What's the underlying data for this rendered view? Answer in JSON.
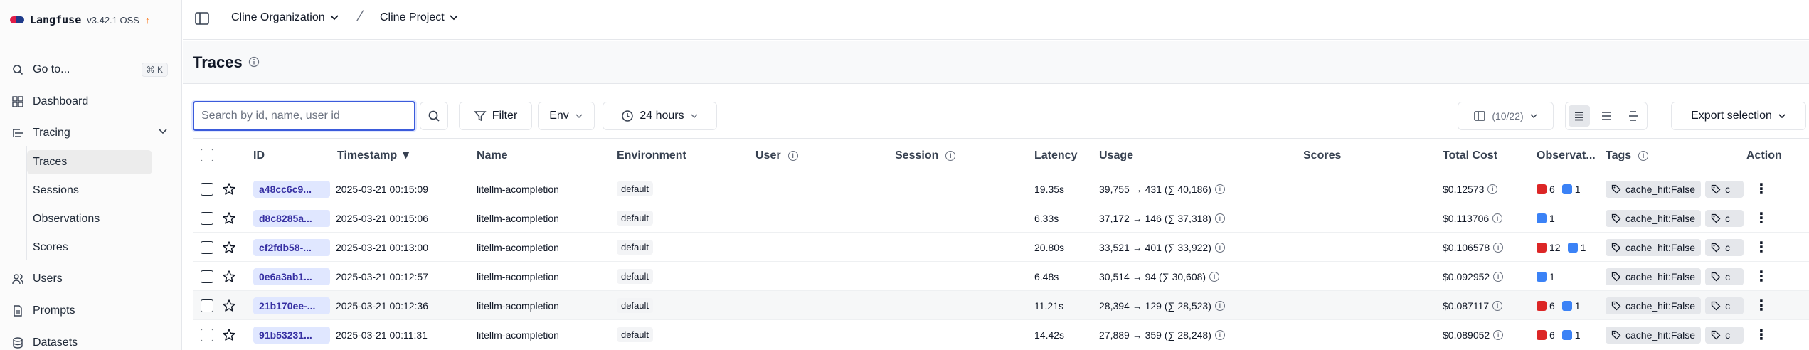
{
  "brand": {
    "name": "Langfuse",
    "version": "v3.42.1 OSS",
    "update_icon": "arrow-up-icon"
  },
  "sidebar": {
    "goto": {
      "label": "Go to...",
      "shortcut": "⌘ K"
    },
    "items": [
      {
        "label": "Dashboard",
        "icon": "dashboard-icon"
      },
      {
        "label": "Tracing",
        "icon": "tracing-icon"
      },
      {
        "label": "Users",
        "icon": "users-icon"
      },
      {
        "label": "Prompts",
        "icon": "prompts-icon"
      },
      {
        "label": "Datasets",
        "icon": "datasets-icon"
      }
    ],
    "tracing_sub": [
      "Traces",
      "Sessions",
      "Observations",
      "Scores"
    ]
  },
  "header": {
    "org": "Cline Organization",
    "project": "Cline Project"
  },
  "page": {
    "title": "Traces"
  },
  "toolbar": {
    "search_placeholder": "Search by id, name, user id",
    "filter_label": "Filter",
    "env_label": "Env",
    "time_label": "24 hours",
    "columns_label": "(10/22)",
    "export_label": "Export selection"
  },
  "table": {
    "headers": {
      "id": "ID",
      "timestamp": "Timestamp ▼",
      "name": "Name",
      "environment": "Environment",
      "user": "User",
      "session": "Session",
      "latency": "Latency",
      "usage": "Usage",
      "scores": "Scores",
      "total_cost": "Total Cost",
      "observations": "Observat...",
      "tags": "Tags",
      "action": "Action"
    },
    "rows": [
      {
        "id": "a48cc6c9...",
        "timestamp": "2025-03-21 00:15:09",
        "name": "litellm-acompletion",
        "env": "default",
        "latency": "19.35s",
        "usage": "39,755 → 431 (∑ 40,186)",
        "cost": "$0.12573",
        "obs_red": "6",
        "obs_blue": "1",
        "tag": "cache_hit:False",
        "tag2": "c"
      },
      {
        "id": "d8c8285a...",
        "timestamp": "2025-03-21 00:15:06",
        "name": "litellm-acompletion",
        "env": "default",
        "latency": "6.33s",
        "usage": "37,172 → 146 (∑ 37,318)",
        "cost": "$0.113706",
        "obs_red": "",
        "obs_blue": "1",
        "tag": "cache_hit:False",
        "tag2": "c"
      },
      {
        "id": "cf2fdb58-...",
        "timestamp": "2025-03-21 00:13:00",
        "name": "litellm-acompletion",
        "env": "default",
        "latency": "20.80s",
        "usage": "33,521 → 401 (∑ 33,922)",
        "cost": "$0.106578",
        "obs_red": "12",
        "obs_blue": "1",
        "tag": "cache_hit:False",
        "tag2": "c"
      },
      {
        "id": "0e6a3ab1...",
        "timestamp": "2025-03-21 00:12:57",
        "name": "litellm-acompletion",
        "env": "default",
        "latency": "6.48s",
        "usage": "30,514 → 94 (∑ 30,608)",
        "cost": "$0.092952",
        "obs_red": "",
        "obs_blue": "1",
        "tag": "cache_hit:False",
        "tag2": "c"
      },
      {
        "id": "21b170ee-...",
        "timestamp": "2025-03-21 00:12:36",
        "name": "litellm-acompletion",
        "env": "default",
        "latency": "11.21s",
        "usage": "28,394 → 129 (∑ 28,523)",
        "cost": "$0.087117",
        "obs_red": "6",
        "obs_blue": "1",
        "tag": "cache_hit:False",
        "tag2": "c"
      },
      {
        "id": "91b53231...",
        "timestamp": "2025-03-21 00:11:31",
        "name": "litellm-acompletion",
        "env": "default",
        "latency": "14.42s",
        "usage": "27,889 → 359 (∑ 28,248)",
        "cost": "$0.089052",
        "obs_red": "6",
        "obs_blue": "1",
        "tag": "cache_hit:False",
        "tag2": "c"
      }
    ]
  },
  "colors": {
    "accent": "#3b5bdb",
    "id_pill_bg": "#e0e7ff",
    "id_pill_text": "#3730a3",
    "error_badge": "#dc2626",
    "info_badge": "#3b82f6"
  }
}
